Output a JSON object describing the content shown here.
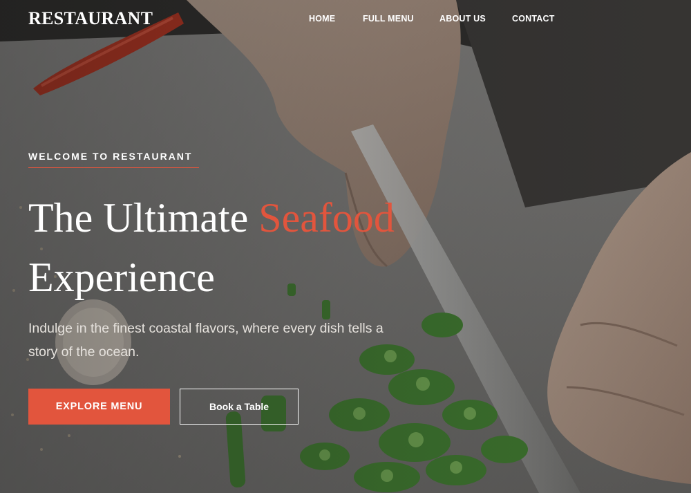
{
  "brand": {
    "logo_text": "RESTAURANT"
  },
  "nav": {
    "items": [
      {
        "label": "HOME"
      },
      {
        "label": "FULL MENU"
      },
      {
        "label": "ABOUT US"
      },
      {
        "label": "CONTACT"
      }
    ]
  },
  "hero": {
    "eyebrow": "WELCOME TO RESTAURANT",
    "headline_part1": "The Ultimate ",
    "headline_accent": "Seafood",
    "headline_part2": "Experience",
    "subtext": "Indulge in the finest coastal flavors, where every dish tells a story of the ocean.",
    "primary_cta": "EXPLORE MENU",
    "secondary_cta": "Book a Table",
    "background_image": "chef-chopping-okra-photo"
  },
  "colors": {
    "accent": "#e2553d",
    "text_light": "#ffffff"
  }
}
